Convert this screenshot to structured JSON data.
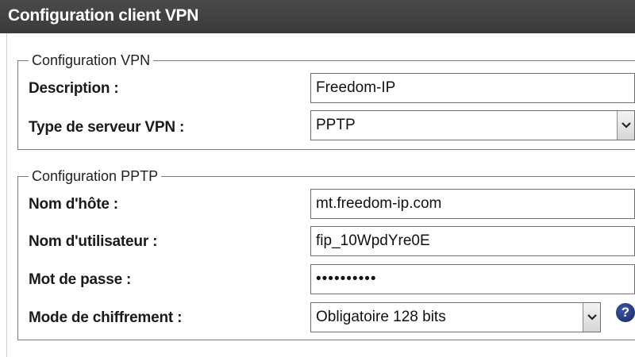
{
  "window": {
    "title": "Configuration client VPN"
  },
  "vpn_config": {
    "legend": "Configuration VPN",
    "description_label": "Description :",
    "description_value": "Freedom-IP",
    "server_type_label": "Type de serveur VPN :",
    "server_type_value": "PPTP"
  },
  "pptp_config": {
    "legend": "Configuration PPTP",
    "hostname_label": "Nom d'hôte :",
    "hostname_value": "mt.freedom-ip.com",
    "username_label": "Nom d'utilisateur :",
    "username_value": "fip_10WpdYre0E",
    "password_label": "Mot de passe :",
    "password_value": "••••••••••",
    "encryption_label": "Mode de chiffrement :",
    "encryption_value": "Obligatoire 128 bits",
    "help_glyph": "?"
  },
  "icons": {
    "dropdown": "chevron-down-icon",
    "help": "help-icon"
  },
  "colors": {
    "titlebar": "#3a3a3a",
    "title_text": "#ffffff",
    "help_icon": "#1b2f74"
  }
}
